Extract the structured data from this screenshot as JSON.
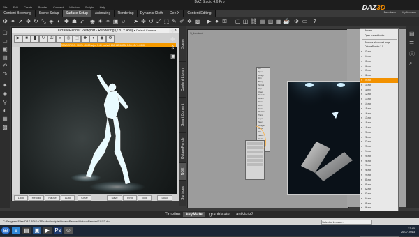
{
  "window": {
    "title": "DAZ Studio 4.6 Pro"
  },
  "menu": [
    "File",
    "Edit",
    "Create",
    "Render",
    "Connect",
    "Window",
    "Scripts",
    "Help"
  ],
  "brand": {
    "text": "DAZ",
    "accent": "3D"
  },
  "top_links": [
    "Feedback",
    "My Account"
  ],
  "tabs": [
    {
      "label": "Content Browsing",
      "active": false
    },
    {
      "label": "Scene Setup",
      "active": false
    },
    {
      "label": "Surface Setup",
      "active": true
    },
    {
      "label": "Animating",
      "active": false
    },
    {
      "label": "Rendering",
      "active": false
    },
    {
      "label": "Dynamic Cloth",
      "active": false
    },
    {
      "label": "Gen X",
      "active": false
    },
    {
      "label": "Content Editing",
      "active": false
    }
  ],
  "viewport": {
    "title": "OctaneRender Viewport - Rendering (720 x 480)",
    "camera": "Default Camera",
    "render_status": "RENDERING: 100% 10000 s/px, 3.40 ms/spl, 600 MB/6 GB, 0:00:10 / 0:00:00",
    "bottom_buttons": [
      "Lock",
      "Reload",
      "Pause",
      "Auto",
      "Clear",
      "Save",
      "Find",
      "Stop",
      "Load"
    ]
  },
  "side_tabs": [
    "Scene",
    "Content Library",
    "Smart Content",
    "OctaneRender",
    "NGE",
    "Surfaces"
  ],
  "node_editor": {
    "header": "S_Leotard",
    "node_items": [
      "Diff",
      "Spec",
      "Rough",
      "Film",
      "Bump",
      "Normal",
      "Disp",
      "Opac",
      "Smooth",
      "Round",
      "Filmw",
      "Filmi",
      "Emiss",
      "Medium",
      "Trans",
      "Layer",
      "Spec2",
      "Rough2",
      "Aniso",
      "Rot",
      "Sheen",
      "Clear",
      "Coat",
      "Thin",
      "Index",
      "Fake",
      "Edge",
      "Mix",
      "Tex",
      "Img",
      "Gen",
      "Proj",
      "UV",
      "Disp2"
    ]
  },
  "dropdown": {
    "header": "Browse",
    "actions": [
      "Open current folder",
      "Remove all unused maps"
    ],
    "section": "OctaneRender 3.5",
    "items": [
      "03.mx",
      "04.mx",
      "05.mx",
      "06.mx",
      "07.mx",
      "08.mx",
      "09.mx",
      "10.mx",
      "11.mx",
      "12.mx",
      "13.mx",
      "14.mx",
      "15.mx",
      "16.mx",
      "17.mx",
      "18.mx",
      "19.mx",
      "20.mx",
      "21.mx",
      "22.mx",
      "23.mx",
      "24.mx",
      "25.mx",
      "26.mx",
      "27.mx",
      "28.mx",
      "29.mx",
      "30.mx",
      "31.mx",
      "32.mx",
      "33.mx",
      "34.mx",
      "35.mx",
      "36.mx",
      "37.mx",
      "38.mx"
    ],
    "selected": "09.mx"
  },
  "bottom_tabs": [
    {
      "label": "Timeline",
      "active": false
    },
    {
      "label": "keyMate",
      "active": true
    },
    {
      "label": "graphMate",
      "active": false
    },
    {
      "label": "aniMate2",
      "active": false
    }
  ],
  "status": {
    "path": "C:\\Program Files\\DAZ 3D\\DAZStudio4\\scripts\\OctaneRender\\OctaneRender\\ECGT.dsa",
    "lesson": "Select a Lesson..."
  },
  "clock": {
    "time": "22:40",
    "date": "26.07.2013"
  },
  "colors": {
    "accent": "#f29100",
    "selection": "#f29100"
  }
}
